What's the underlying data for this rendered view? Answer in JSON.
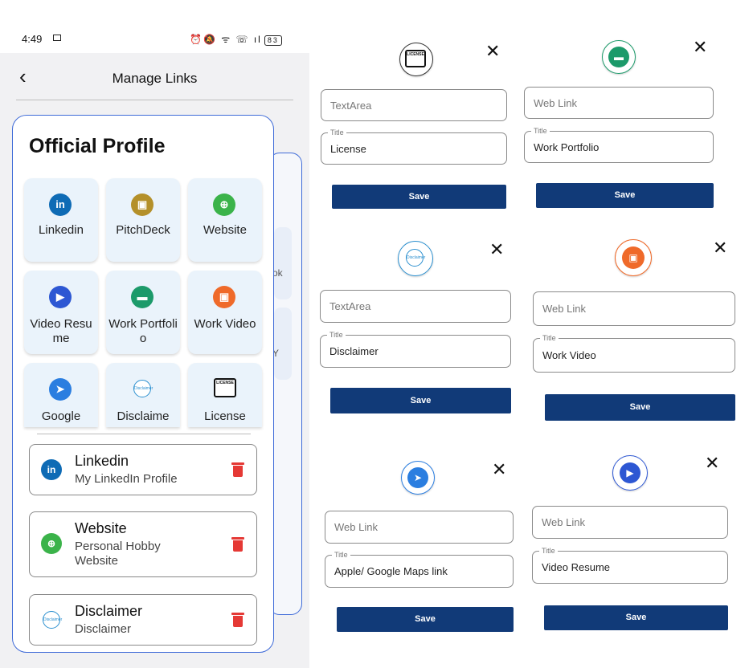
{
  "status": {
    "time": "4:49",
    "icons": "⏰🔕 ᯤ ☏ ıl",
    "battery": "83"
  },
  "appbar": {
    "back": "‹",
    "title": "Manage Links"
  },
  "modal": {
    "title": "Official Profile",
    "tiles": [
      {
        "label": "Linkedin",
        "icon": "linkedin-icon",
        "color": "#0e6bb5",
        "glyph": "in"
      },
      {
        "label": "PitchDeck",
        "icon": "pitchdeck-icon",
        "color": "#b4902a",
        "glyph": "▣"
      },
      {
        "label": "Website",
        "icon": "globe-icon",
        "color": "#3bb34a",
        "glyph": "⊕"
      },
      {
        "label": "Video Resume",
        "icon": "video-icon",
        "color": "#2d57d3",
        "glyph": "▶"
      },
      {
        "label": "Work Portfolio",
        "icon": "folder-icon",
        "color": "#1c9a6a",
        "glyph": "▬"
      },
      {
        "label": "Work Video",
        "icon": "work-video-icon",
        "color": "#ef6a2a",
        "glyph": "▣"
      },
      {
        "label": "Google",
        "icon": "navigation-icon",
        "color": "#2b7ee0",
        "glyph": "➤"
      },
      {
        "label": "Disclaime",
        "icon": "disclaimer-icon",
        "color": "#2a8fcf",
        "glyph": "D"
      },
      {
        "label": "License",
        "icon": "license-icon",
        "color": "#111111",
        "glyph": "L"
      }
    ],
    "cards": [
      {
        "title": "Linkedin",
        "subtitle": "My LinkedIn Profile",
        "icon": "linkedin-icon",
        "color": "#0e6bb5",
        "glyph": "in"
      },
      {
        "title": "Website",
        "subtitle": "Personal Hobby Website",
        "icon": "globe-icon",
        "color": "#3bb34a",
        "glyph": "⊕"
      },
      {
        "title": "Disclaimer",
        "subtitle": "Disclaimer",
        "icon": "disclaimer-icon",
        "color": "#2a8fcf",
        "glyph": "D"
      }
    ]
  },
  "dialogs": [
    {
      "icon": "license-icon",
      "color": "#111111",
      "field1": "TextArea",
      "title_legend": "Title",
      "title_value": "License",
      "save": "Save",
      "close": "✕"
    },
    {
      "icon": "folder-icon",
      "color": "#1c9a6a",
      "field1": "Web Link",
      "title_legend": "Title",
      "title_value": "Work Portfolio",
      "save": "Save",
      "close": "✕"
    },
    {
      "icon": "disclaimer-icon",
      "color": "#2a8fcf",
      "field1": "TextArea",
      "title_legend": "Title",
      "title_value": "Disclaimer",
      "save": "Save",
      "close": "✕"
    },
    {
      "icon": "work-video-icon",
      "color": "#ef6a2a",
      "field1": "Web Link",
      "title_legend": "Title",
      "title_value": "Work Video",
      "save": "Save",
      "close": "✕"
    },
    {
      "icon": "navigation-icon",
      "color": "#2b7ee0",
      "field1": "Web Link",
      "title_legend": "Title",
      "title_value": "Apple/ Google Maps link",
      "save": "Save",
      "close": "✕"
    },
    {
      "icon": "video-icon",
      "color": "#2d57d3",
      "field1": "Web Link",
      "title_legend": "Title",
      "title_value": "Video Resume",
      "save": "Save",
      "close": "✕"
    }
  ],
  "background_labels": {
    "a": "ok",
    "b": "Y"
  },
  "colors": {
    "accent": "#3f6bd8",
    "save": "#113a78",
    "delete": "#e53935"
  }
}
